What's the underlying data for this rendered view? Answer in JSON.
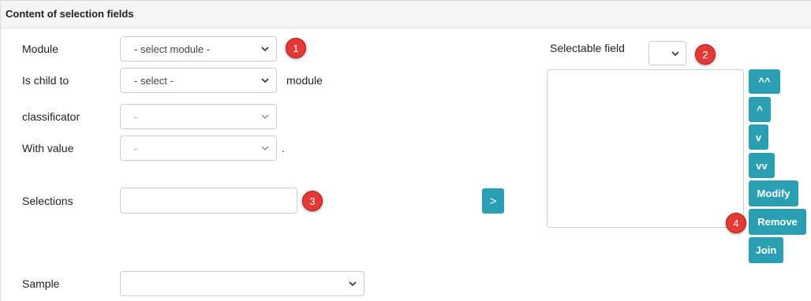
{
  "panel": {
    "title": "Content of selection fields"
  },
  "form": {
    "module_label": "Module",
    "module_value": "- select module -",
    "is_child_label": "Is child to",
    "is_child_value": "- select -",
    "is_child_suffix": "module",
    "classificator_label": "classificator",
    "classificator_value": "-",
    "with_value_label": "With value",
    "with_value_value": "-",
    "with_value_suffix": ".",
    "selections_label": "Selections",
    "selections_value": "",
    "sample_label": "Sample",
    "sample_value": "",
    "add_button": ">"
  },
  "right": {
    "selectable_field_label": "Selectable field",
    "selectable_field_value": "",
    "buttons": {
      "top": "^^",
      "up": "^",
      "down": "v",
      "bottom": "vv",
      "modify": "Modify",
      "remove": "Remove",
      "join": "Join"
    }
  },
  "badges": [
    "1",
    "2",
    "3",
    "4"
  ],
  "colors": {
    "accent": "#2a9fb4",
    "badge": "#e53935"
  }
}
